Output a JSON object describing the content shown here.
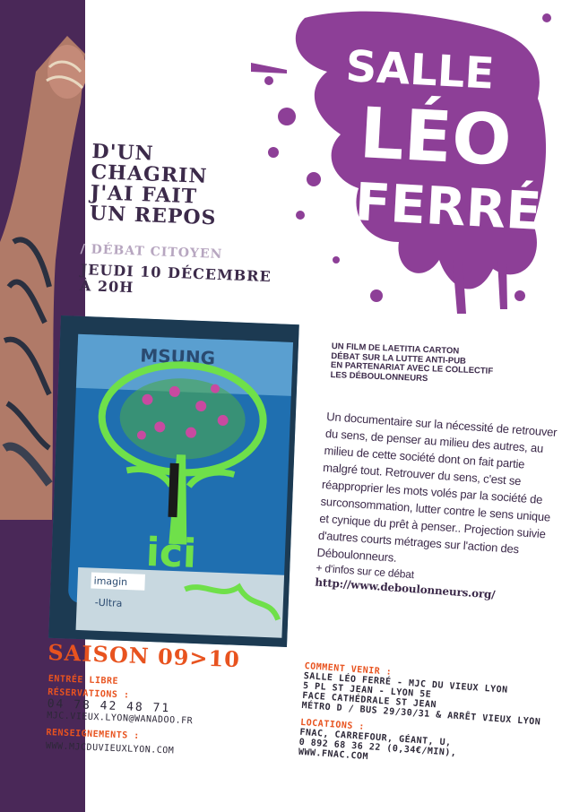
{
  "venue": {
    "line1": "SALLE",
    "line2": "LÉO",
    "line3": "FERRÉ"
  },
  "title": {
    "line1": "D'UN",
    "line2": "CHAGRIN",
    "line3": "J'AI FAIT",
    "line4": "UN REPOS"
  },
  "subtitle": "/ DÉBAT CITOYEN",
  "date": {
    "line1": "JEUDI 10 DÉCEMBRE",
    "line2": "À 20H"
  },
  "photo": {
    "logo": "MSUNG",
    "word": "ici",
    "sticker": "imagin",
    "ultra": "-Ultra"
  },
  "credits": [
    "UN FILM DE LAETITIA CARTON",
    "DÉBAT SUR LA LUTTE ANTI-PUB",
    "EN PARTENARIAT AVEC LE COLLECTIF",
    "LES DÉBOULONNEURS"
  ],
  "description": "Un documentaire sur la nécessité de retrouver du sens, de penser au milieu des autres, au milieu de cette société dont on fait partie malgré tout. Retrouver du sens, c'est se réapproprier les mots volés par la société de surconsommation, lutter contre le sens unique et cynique du prêt à penser.. Projection suivie d'autres courts métrages sur l'action des Déboulonneurs.",
  "more_info": "+ d'infos sur ce débat",
  "more_info_url": "http://www.deboulonneurs.org/",
  "saison": "SAISON 09>10",
  "entry": "ENTRÉE LIBRE",
  "reservations": {
    "label": "RÉSERVATIONS :",
    "phone": "04 78 42 48 71",
    "email": "MJC.VIEUX.LYON@WANADOO.FR"
  },
  "renseignements": {
    "label": "RENSEIGNEMENTS :",
    "url": "WWW.MJCDUVIEUXLYON.COM"
  },
  "directions": {
    "label": "COMMENT VENIR :",
    "line1": "SALLE LÉO FERRÉ - MJC DU VIEUX LYON",
    "line2": "5 PL ST JEAN - LYON 5E",
    "line3": "FACE CATHÉDRALE ST JEAN",
    "line4": "MÉTRO D / BUS 29/30/31 & ARRÊT VIEUX LYON"
  },
  "locations": {
    "label": "LOCATIONS :",
    "line1": "FNAC, CARREFOUR, GÉANT, U,",
    "line2": "0 892 68 36 22 (0,34€/MIN),",
    "line3": "WWW.FNAC.COM"
  },
  "colors": {
    "purple": "#8d3f97",
    "dark": "#3c2a4a",
    "orange": "#e8531f",
    "left_band": "#4a2858"
  }
}
